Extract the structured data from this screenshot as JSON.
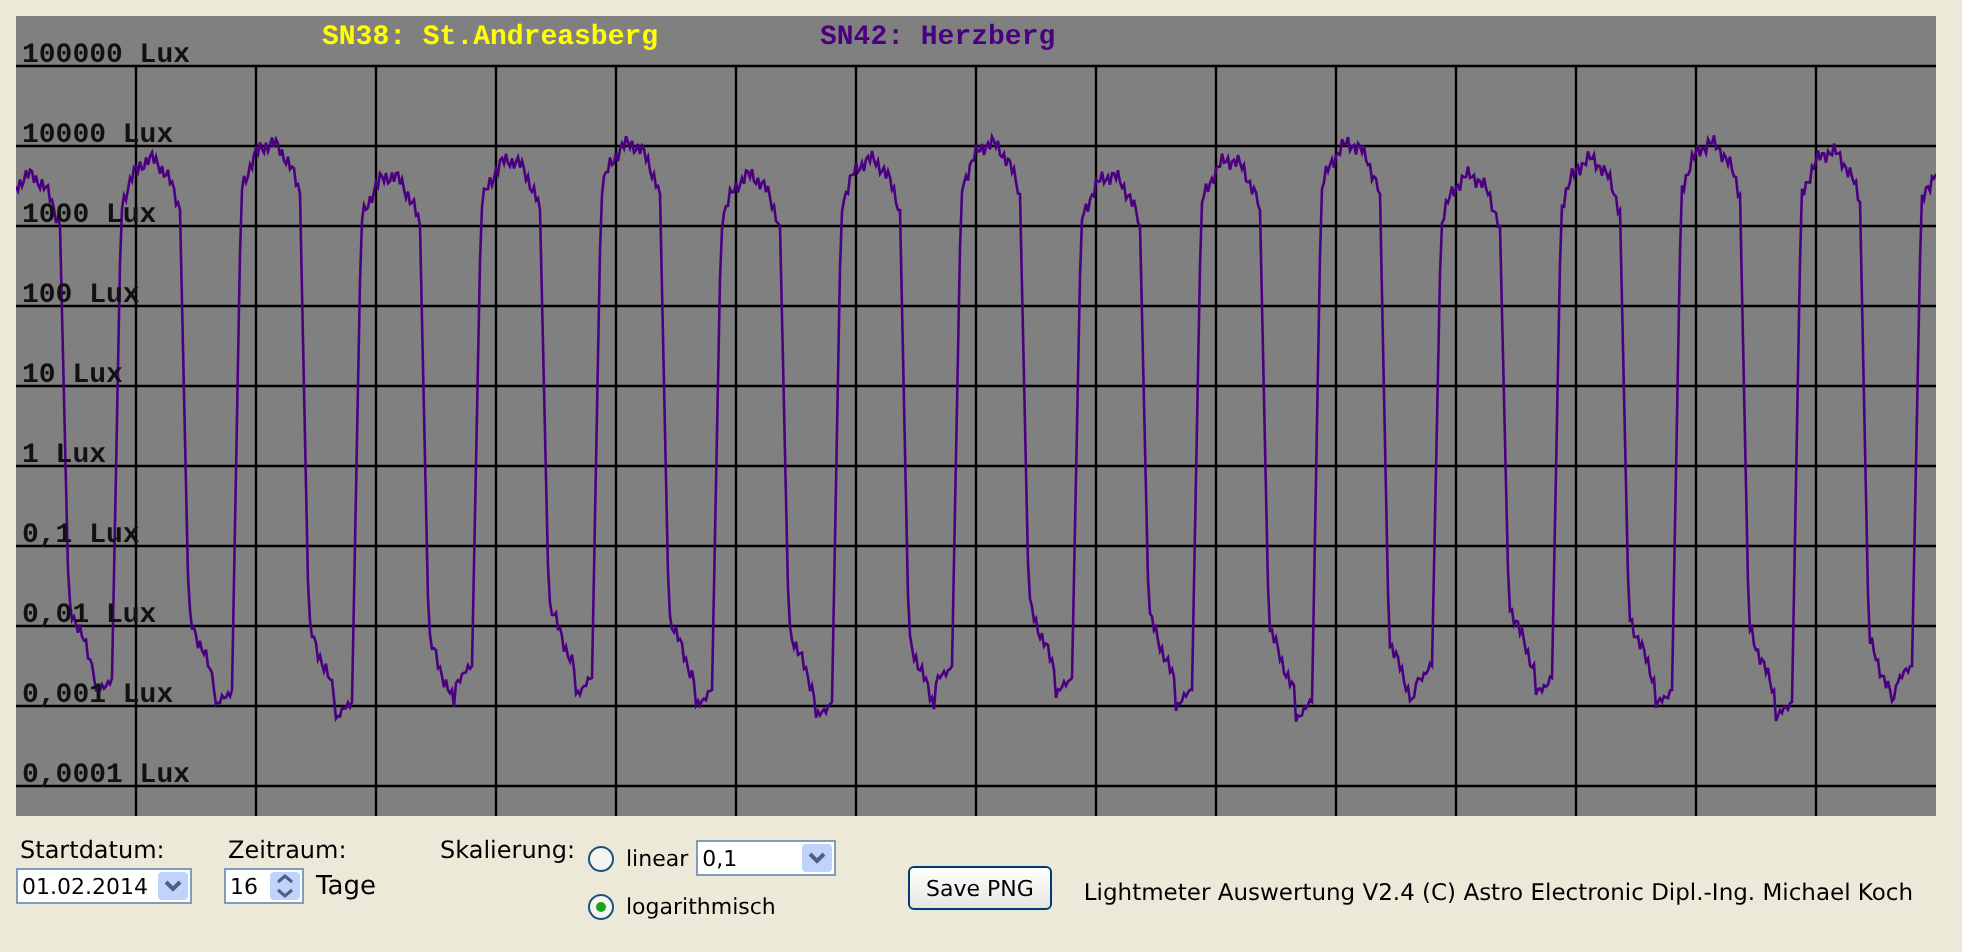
{
  "legend": [
    {
      "label": "SN38: St.Andreasberg",
      "color": "#ffff00"
    },
    {
      "label": "SN42: Herzberg",
      "color": "#4b0082"
    }
  ],
  "y_axis_labels": [
    "100000 Lux",
    "10000 Lux",
    "1000 Lux",
    "100 Lux",
    "10 Lux",
    "1 Lux",
    "0,1 Lux",
    "0,01 Lux",
    "0,001 Lux",
    "0,0001 Lux"
  ],
  "start_date": {
    "label": "Startdatum:",
    "value": "01.02.2014"
  },
  "period": {
    "label": "Zeitraum:",
    "value": "16",
    "unit": "Tage"
  },
  "scaling": {
    "label": "Skalierung:",
    "options": [
      {
        "label": "linear",
        "selected": false
      },
      {
        "label": "logarithmisch",
        "selected": true
      }
    ],
    "linear_value": "0,1"
  },
  "save_button": "Save PNG",
  "footer": "Lightmeter Auswertung V2.4  (C) Astro Electronic Dipl.-Ing. Michael Koch"
}
